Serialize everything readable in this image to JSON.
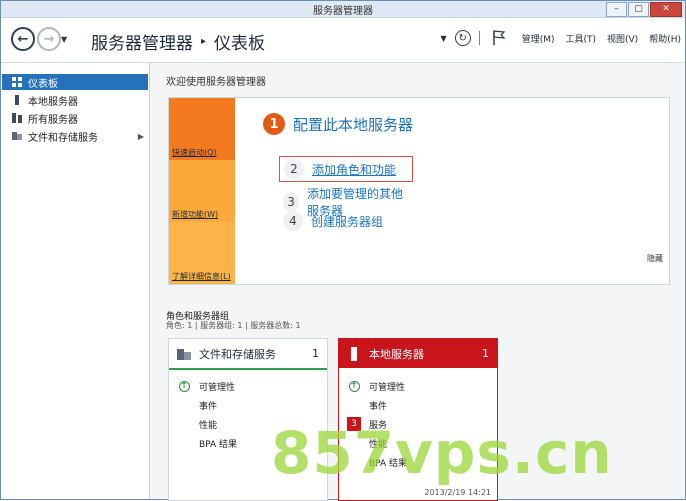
{
  "window": {
    "title": "服务器管理器",
    "buttons": {
      "minimize": "–",
      "maximize": "▢",
      "close": "✕"
    }
  },
  "toolbar": {
    "breadcrumb": [
      "服务器管理器",
      "仪表板"
    ],
    "menus": [
      "管理(M)",
      "工具(T)",
      "视图(V)",
      "帮助(H)"
    ]
  },
  "sidebar": {
    "items": [
      {
        "label": "仪表板",
        "icon": "dashboard-icon",
        "active": true
      },
      {
        "label": "本地服务器",
        "icon": "server-icon"
      },
      {
        "label": "所有服务器",
        "icon": "servers-icon"
      },
      {
        "label": "文件和存储服务",
        "icon": "storage-icon",
        "expandable": true
      }
    ]
  },
  "welcome": {
    "title": "欢迎使用服务器管理器",
    "tiles": [
      "快速启动(Q)",
      "新增功能(W)",
      "了解详细信息(L)"
    ],
    "step1": {
      "num": "1",
      "label": "配置此本地服务器"
    },
    "steps": [
      {
        "num": "2",
        "label": "添加角色和功能"
      },
      {
        "num": "3",
        "label": "添加要管理的其他服务器"
      },
      {
        "num": "4",
        "label": "创建服务器组"
      }
    ],
    "hide": "隐藏"
  },
  "roles": {
    "heading": "角色和服务器组",
    "summary": "角色: 1 | 服务器组: 1 | 服务器总数: 1",
    "cards": [
      {
        "title": "文件和存储服务",
        "count": "1",
        "rows": [
          "可管理性",
          "事件",
          "性能",
          "BPA 结果"
        ]
      },
      {
        "title": "本地服务器",
        "count": "1",
        "rows": [
          "可管理性",
          "事件",
          "服务",
          "性能",
          "BPA 结果"
        ],
        "badge": "3",
        "timestamp": "2013/2/19 14:21"
      }
    ]
  },
  "watermark": "857vps.cn",
  "colors": {
    "accent": "#2672ba",
    "quickstart": "#f47a20",
    "alert": "#c9141c",
    "ok": "#2b8a3e"
  }
}
